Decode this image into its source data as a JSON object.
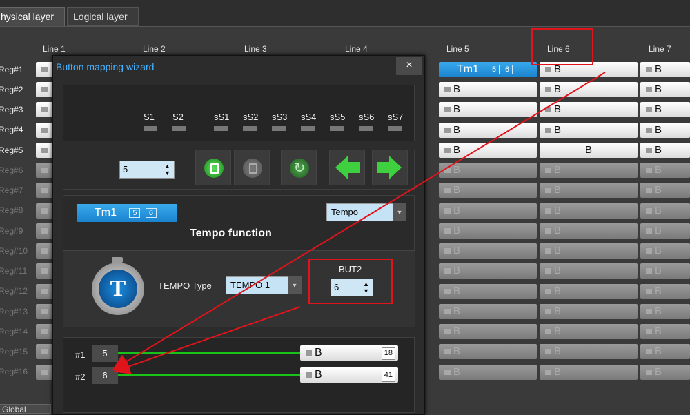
{
  "tabs": {
    "physical": "hysical layer",
    "logical": "Logical layer"
  },
  "lines": [
    "Line 1",
    "Line 2",
    "Line 3",
    "Line 4",
    "Line 5",
    "Line 6",
    "Line 7"
  ],
  "rows": [
    "Reg#1",
    "Reg#2",
    "Reg#3",
    "Reg#4",
    "Reg#5",
    "Reg#6",
    "Reg#7",
    "Reg#8",
    "Reg#9",
    "Reg#10",
    "Reg#11",
    "Reg#12",
    "Reg#13",
    "Reg#14",
    "Reg#15",
    "Reg#16"
  ],
  "cell_label": "B",
  "tm_cell": {
    "label": "Tm1",
    "a": "5",
    "b": "6"
  },
  "bottom_tab": "Global",
  "wizard": {
    "title": "Button mapping wizard",
    "close": "×",
    "s_labels": [
      "S1",
      "S2",
      "sS1",
      "sS2",
      "sS3",
      "sS4",
      "sS5",
      "sS6",
      "sS7"
    ],
    "spin_value": "5",
    "tm": {
      "label": "Tm1",
      "a": "5",
      "b": "6"
    },
    "mode_select": "Tempo",
    "function_title": "Tempo function",
    "tempo_icon_letter": "T",
    "tempo_type_label": "TEMPO Type",
    "tempo_type_value": "TEMPO 1",
    "but2_label": "BUT2",
    "but2_value": "6",
    "map": [
      {
        "id": "#1",
        "num": "5",
        "btn": "B",
        "count": "18"
      },
      {
        "id": "#2",
        "num": "6",
        "btn": "B",
        "count": "41"
      }
    ]
  },
  "colors": {
    "accent": "#1a8ee0",
    "highlight": "#e0141a",
    "link": "#19c219"
  }
}
